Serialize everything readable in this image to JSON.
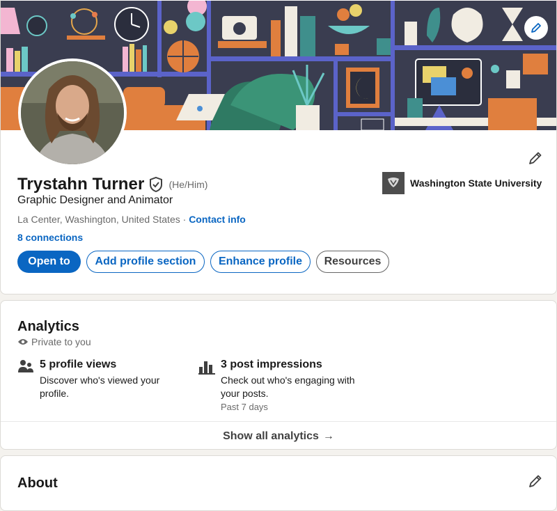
{
  "profile": {
    "name": "Trystahn Turner",
    "pronouns": "(He/Him)",
    "headline": "Graphic Designer and Animator",
    "location": "La Center, Washington, United States",
    "location_separator": " · ",
    "contact_info": "Contact info",
    "connections": "8 connections",
    "education": "Washington State University"
  },
  "actions": {
    "open_to": "Open to",
    "add_section": "Add profile section",
    "enhance": "Enhance profile",
    "resources": "Resources"
  },
  "analytics": {
    "title": "Analytics",
    "privacy": "Private to you",
    "metrics": [
      {
        "title": "5 profile views",
        "description": "Discover who's viewed your profile.",
        "icon": "people-icon"
      },
      {
        "title": "3 post impressions",
        "description": "Check out who's engaging with your posts.",
        "period": "Past 7 days",
        "icon": "bar-chart-icon"
      }
    ],
    "show_all": "Show all analytics",
    "arrow": "→"
  },
  "about": {
    "title": "About"
  },
  "colors": {
    "brand_blue": "#0a66c2",
    "page_background": "#f4f2ee",
    "cover_background": "#3c3f52"
  }
}
